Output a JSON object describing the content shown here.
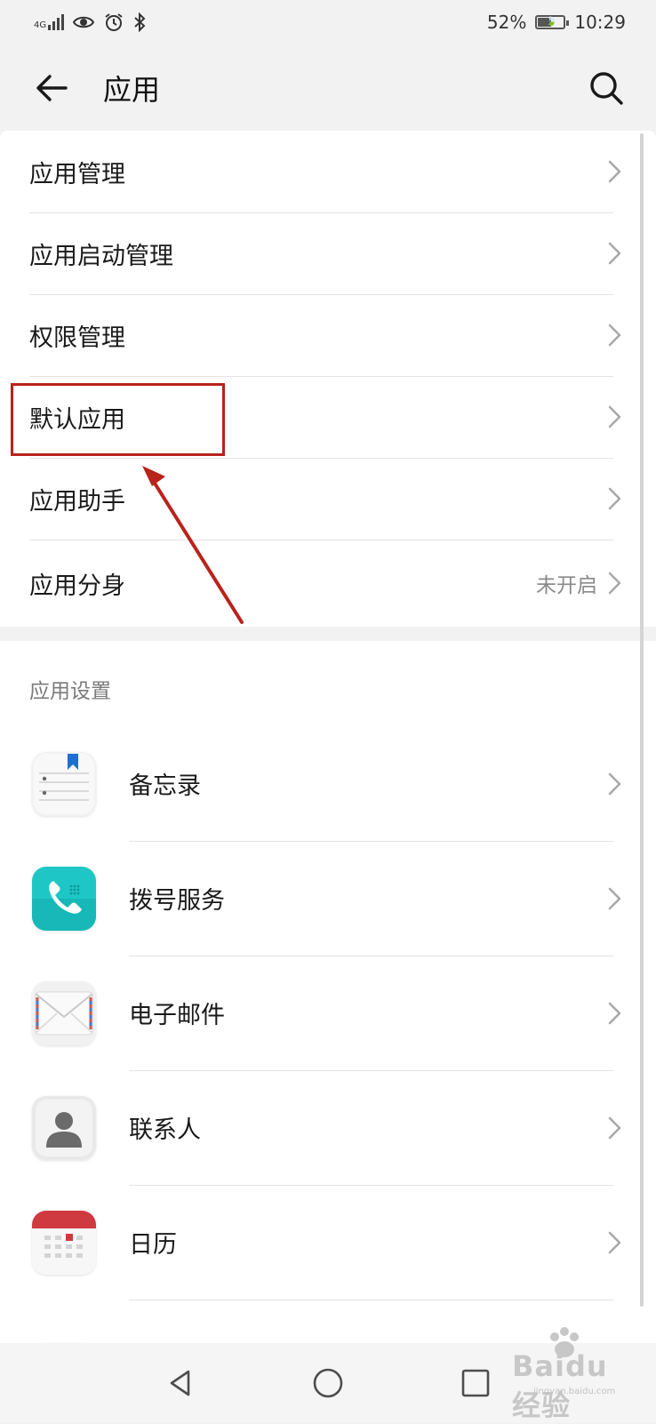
{
  "status_bar": {
    "network": "4G",
    "battery_percent": "52%",
    "battery_level": 0.52,
    "time": "10:29"
  },
  "header": {
    "title": "应用",
    "back_icon": "arrow-left-icon",
    "search_icon": "search-icon"
  },
  "menu": {
    "items": [
      {
        "label": "应用管理"
      },
      {
        "label": "应用启动管理"
      },
      {
        "label": "权限管理"
      },
      {
        "label": "默认应用"
      },
      {
        "label": "应用助手"
      },
      {
        "label": "应用分身",
        "value": "未开启"
      }
    ]
  },
  "app_settings": {
    "title": "应用设置",
    "items": [
      {
        "label": "备忘录",
        "icon": "notepad-icon"
      },
      {
        "label": "拨号服务",
        "icon": "phone-icon"
      },
      {
        "label": "电子邮件",
        "icon": "mail-icon"
      },
      {
        "label": "联系人",
        "icon": "contact-icon"
      },
      {
        "label": "日历",
        "icon": "calendar-icon"
      }
    ]
  },
  "nav_bar": {
    "back_icon": "nav-back-icon",
    "home_icon": "nav-home-icon",
    "recent_icon": "nav-recent-icon"
  },
  "watermark": {
    "text": "Baidu经验",
    "subtext": "jingyan.baidu.com"
  },
  "colors": {
    "background": "#f2f2f2",
    "card": "#ffffff",
    "annotation": "#b8231b",
    "phone_icon": "#1ec7c6",
    "calendar_icon": "#cf3a40"
  }
}
